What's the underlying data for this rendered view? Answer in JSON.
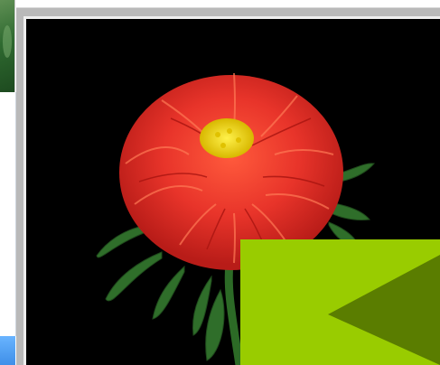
{
  "viewer": {
    "photo": {
      "icon": "flower-photo"
    },
    "prev_button": {
      "icon": "triangle-left-icon",
      "color": "#99cc00",
      "arrow_color": "#5a7d00"
    }
  },
  "sidebar": {
    "thumbnail_icon": "plant-thumbnail",
    "bar_color": "#3f8fe8"
  }
}
